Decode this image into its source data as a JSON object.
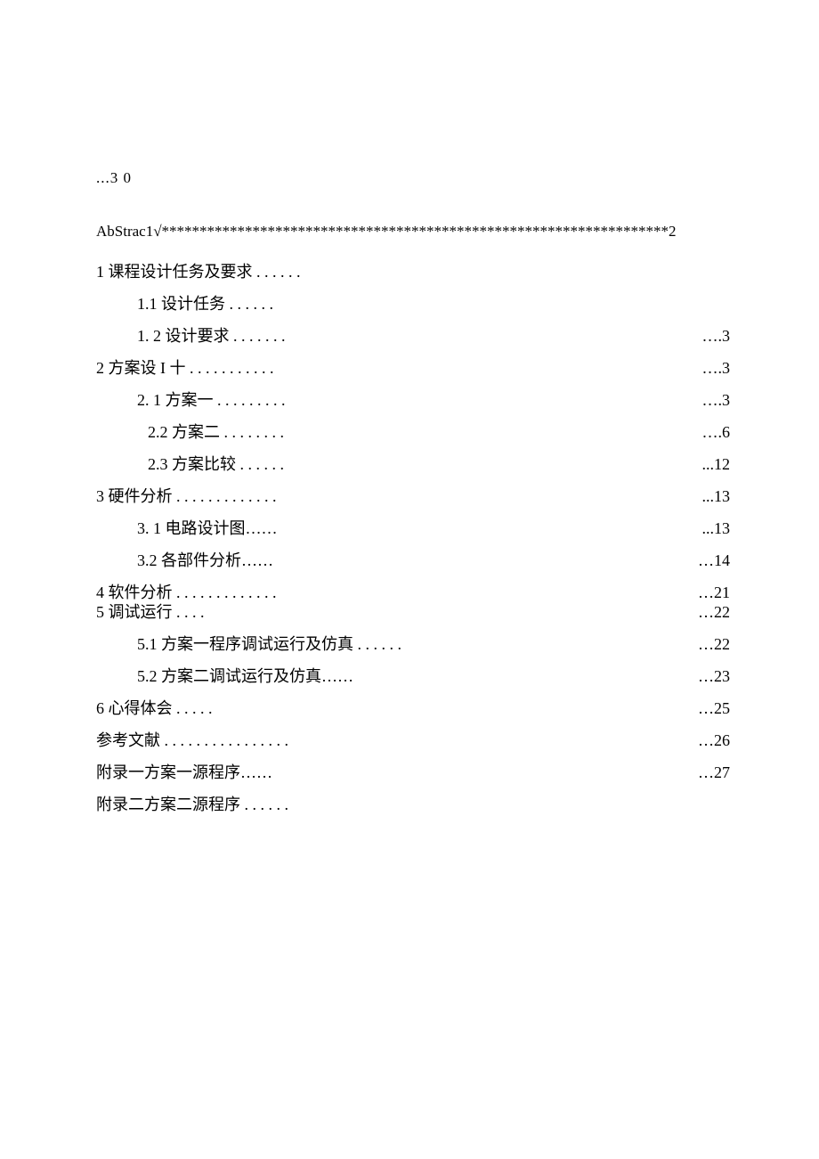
{
  "top_note": "...3 0",
  "abstract_line": "AbStrac1√*******************************************************************2",
  "entries": [
    {
      "label": "1 课程设计任务及要求 . . . . . .",
      "page": "",
      "indent": 0
    },
    {
      "label": "1.1 设计任务 . . . . . .",
      "page": "",
      "indent": 1
    },
    {
      "label": "1. 2 设计要求 . . . . . . .",
      "page": "….3",
      "indent": 1
    },
    {
      "label": "2 方案设 I 十  . . . . . . . . . . .",
      "page": "….3",
      "indent": 0
    },
    {
      "label": "2. 1 方案一 . . . . . . . . .",
      "page": "….3",
      "indent": 1
    },
    {
      "label": "2.2   方案二 . . . . . . . .",
      "page": "….6",
      "indent": 2
    },
    {
      "label": "2.3   方案比较 . . . . . .",
      "page": "...12",
      "indent": 2
    },
    {
      "label": "3 硬件分析 . . . . . . . . . . . . .",
      "page": "...13",
      "indent": 0
    },
    {
      "label": "3. 1 电路设计图……",
      "page": "...13",
      "indent": 1
    },
    {
      "label": "3.2 各部件分析……",
      "page": "…14",
      "indent": 1
    },
    {
      "label": "4 软件分析 . . . . . . . . . . . . .",
      "page": "…21",
      "indent": 0,
      "tight": true
    },
    {
      "label": "5 调试运行 . . . .",
      "page": "…22",
      "indent": 0
    },
    {
      "label": "5.1 方案一程序调试运行及仿真  . . . . . .",
      "page": "…22",
      "indent": 1
    },
    {
      "label": "5.2 方案二调试运行及仿真……",
      "page": "…23",
      "indent": 1
    },
    {
      "label": "6 心得体会 . . . . .",
      "page": "…25",
      "indent": 0
    },
    {
      "label": "参考文献 . . . . . . . . . . . . . . . .",
      "page": "…26",
      "indent": 0
    },
    {
      "label": "附录一方案一源程序……",
      "page": "…27",
      "indent": 0
    },
    {
      "label": "附录二方案二源程序 . . . . . .",
      "page": "",
      "indent": 0
    }
  ]
}
